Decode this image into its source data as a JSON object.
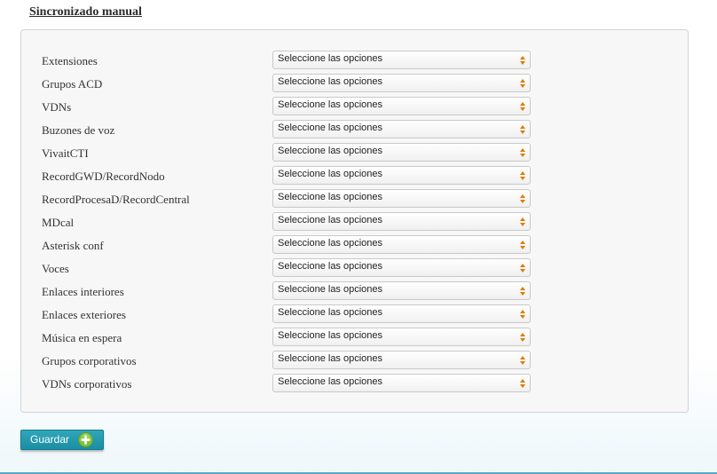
{
  "section": {
    "title": "Sincronizado manual"
  },
  "form": {
    "rows": [
      {
        "label": "Extensiones",
        "value": "Seleccione las opciones"
      },
      {
        "label": "Grupos ACD",
        "value": "Seleccione las opciones"
      },
      {
        "label": "VDNs",
        "value": "Seleccione las opciones"
      },
      {
        "label": "Buzones de voz",
        "value": "Seleccione las opciones"
      },
      {
        "label": "VivaitCTI",
        "value": "Seleccione las opciones"
      },
      {
        "label": "RecordGWD/RecordNodo",
        "value": "Seleccione las opciones"
      },
      {
        "label": "RecordProcesaD/RecordCentral",
        "value": "Seleccione las opciones"
      },
      {
        "label": "MDcal",
        "value": "Seleccione las opciones"
      },
      {
        "label": "Asterisk conf",
        "value": "Seleccione las opciones"
      },
      {
        "label": "Voces",
        "value": "Seleccione las opciones"
      },
      {
        "label": "Enlaces interiores",
        "value": "Seleccione las opciones"
      },
      {
        "label": "Enlaces exteriores",
        "value": "Seleccione las opciones"
      },
      {
        "label": "Música en espera",
        "value": "Seleccione las opciones"
      },
      {
        "label": "Grupos corporativos",
        "value": "Seleccione las opciones"
      },
      {
        "label": "VDNs corporativos",
        "value": "Seleccione las opciones"
      }
    ]
  },
  "actions": {
    "save_label": "Guardar",
    "save_icon": "plus-circle-icon"
  },
  "colors": {
    "button": "#1f97ad",
    "icon_green": "#7dc242",
    "arrow_orange": "#e07b00"
  }
}
